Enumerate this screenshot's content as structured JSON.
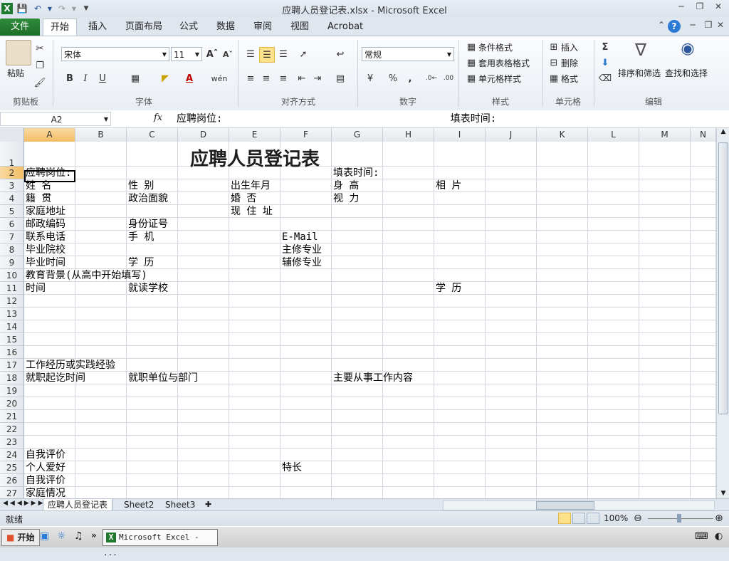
{
  "window": {
    "title": "应聘人员登记表.xlsx - Microsoft Excel",
    "app_icon": "X"
  },
  "ribbon": {
    "tabs": [
      "文件",
      "开始",
      "插入",
      "页面布局",
      "公式",
      "数据",
      "审阅",
      "视图",
      "Acrobat"
    ],
    "active_tab": "开始",
    "clipboard": {
      "paste": "粘贴",
      "group": "剪贴板"
    },
    "font": {
      "name": "宋体",
      "size": "11",
      "group": "字体"
    },
    "alignment": {
      "group": "对齐方式"
    },
    "number": {
      "format": "常规",
      "group": "数字"
    },
    "styles": {
      "conditional": "条件格式",
      "table": "套用表格格式",
      "cell": "单元格样式",
      "group": "样式"
    },
    "cells": {
      "insert": "插入",
      "delete": "删除",
      "format": "格式",
      "group": "单元格"
    },
    "editing": {
      "sort": "排序和筛选",
      "find": "查找和选择",
      "group": "编辑"
    }
  },
  "formula_bar": {
    "name_box": "A2",
    "fx": "fx",
    "content": "应聘岗位:                                      填表时间:"
  },
  "columns": [
    "A",
    "B",
    "C",
    "D",
    "E",
    "F",
    "G",
    "H",
    "I",
    "J",
    "K",
    "L",
    "M",
    "N"
  ],
  "rows": [
    "1",
    "2",
    "3",
    "4",
    "5",
    "6",
    "7",
    "8",
    "9",
    "10",
    "11",
    "12",
    "13",
    "14",
    "15",
    "16",
    "17",
    "18",
    "19",
    "20",
    "21",
    "22",
    "23",
    "24",
    "25",
    "26",
    "27"
  ],
  "sheet": {
    "title": "应聘人员登记表",
    "cells": [
      {
        "row": 2,
        "col": "A",
        "text": "应聘岗位:"
      },
      {
        "row": 2,
        "col": "G",
        "text": "填表时间:"
      },
      {
        "row": 3,
        "col": "A",
        "text": "姓      名"
      },
      {
        "row": 3,
        "col": "C",
        "text": "性      别"
      },
      {
        "row": 3,
        "col": "E",
        "text": "出生年月"
      },
      {
        "row": 3,
        "col": "G",
        "text": "身     高"
      },
      {
        "row": 3,
        "col": "I",
        "text": "相      片"
      },
      {
        "row": 4,
        "col": "A",
        "text": "籍      贯"
      },
      {
        "row": 4,
        "col": "C",
        "text": "政治面貌"
      },
      {
        "row": 4,
        "col": "E",
        "text": "婚      否"
      },
      {
        "row": 4,
        "col": "G",
        "text": "视   力"
      },
      {
        "row": 5,
        "col": "A",
        "text": "家庭地址"
      },
      {
        "row": 5,
        "col": "E",
        "text": "现 住 址"
      },
      {
        "row": 6,
        "col": "A",
        "text": "邮政编码"
      },
      {
        "row": 6,
        "col": "C",
        "text": "身份证号"
      },
      {
        "row": 7,
        "col": "A",
        "text": "联系电话"
      },
      {
        "row": 7,
        "col": "C",
        "text": "手      机"
      },
      {
        "row": 7,
        "col": "F",
        "text": "E-Mail"
      },
      {
        "row": 8,
        "col": "A",
        "text": "毕业院校"
      },
      {
        "row": 8,
        "col": "F",
        "text": "主修专业"
      },
      {
        "row": 9,
        "col": "A",
        "text": "毕业时间"
      },
      {
        "row": 9,
        "col": "C",
        "text": "学      历"
      },
      {
        "row": 9,
        "col": "F",
        "text": "辅修专业"
      },
      {
        "row": 10,
        "col": "A",
        "text": "教育背景(从高中开始填写)"
      },
      {
        "row": 11,
        "col": "A",
        "text": "时间"
      },
      {
        "row": 11,
        "col": "C",
        "text": "就读学校"
      },
      {
        "row": 11,
        "col": "I",
        "text": "学      历"
      },
      {
        "row": 17,
        "col": "A",
        "text": "工作经历或实践经验"
      },
      {
        "row": 18,
        "col": "A",
        "text": "就职起讫时间"
      },
      {
        "row": 18,
        "col": "C",
        "text": "就职单位与部门"
      },
      {
        "row": 18,
        "col": "G",
        "text": "主要从事工作内容"
      },
      {
        "row": 24,
        "col": "A",
        "text": "自我评价"
      },
      {
        "row": 25,
        "col": "A",
        "text": "个人爱好"
      },
      {
        "row": 25,
        "col": "F",
        "text": "特长"
      },
      {
        "row": 26,
        "col": "A",
        "text": "自我评价"
      },
      {
        "row": 27,
        "col": "A",
        "text": "家庭情况"
      }
    ]
  },
  "sheet_tabs": [
    "应聘人员登记表",
    "Sheet2",
    "Sheet3"
  ],
  "status": {
    "ready": "就绪",
    "zoom": "100%"
  },
  "taskbar": {
    "start": "开始",
    "task": "Microsoft Excel - ..."
  },
  "colors": {
    "file_tab": "#1e7a2e",
    "selection": "#000000",
    "accent": "#2b579a"
  }
}
